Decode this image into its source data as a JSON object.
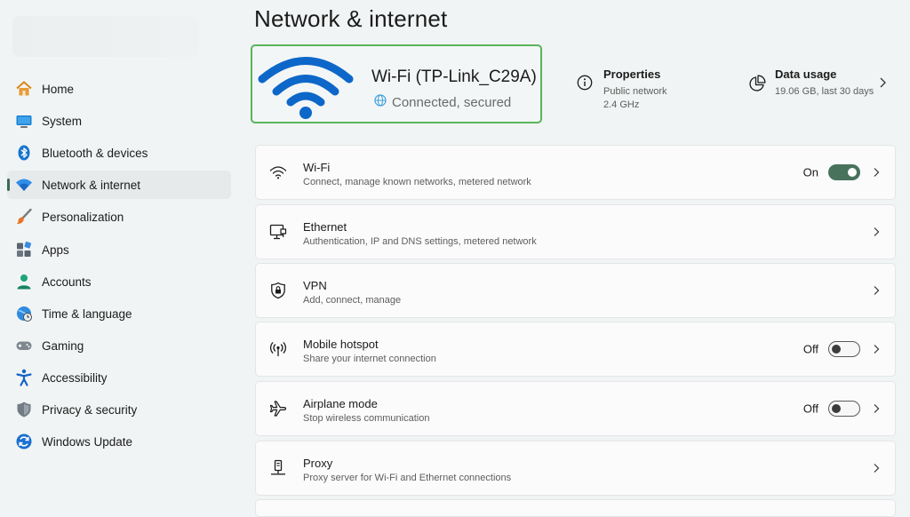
{
  "page": {
    "title": "Network & internet"
  },
  "sidebar": {
    "items": [
      {
        "label": "Home",
        "icon": "home-icon"
      },
      {
        "label": "System",
        "icon": "system-icon"
      },
      {
        "label": "Bluetooth & devices",
        "icon": "bluetooth-icon"
      },
      {
        "label": "Network & internet",
        "icon": "network-icon",
        "active": true
      },
      {
        "label": "Personalization",
        "icon": "brush-icon"
      },
      {
        "label": "Apps",
        "icon": "apps-icon"
      },
      {
        "label": "Accounts",
        "icon": "accounts-icon"
      },
      {
        "label": "Time & language",
        "icon": "time-language-icon"
      },
      {
        "label": "Gaming",
        "icon": "gamepad-icon"
      },
      {
        "label": "Accessibility",
        "icon": "accessibility-icon"
      },
      {
        "label": "Privacy & security",
        "icon": "shield-icon"
      },
      {
        "label": "Windows Update",
        "icon": "update-icon"
      }
    ]
  },
  "hero": {
    "ssid": "Wi-Fi (TP-Link_C29A)",
    "status": "Connected, secured",
    "accent": "#5bb35d",
    "wifi_color": "#0d67c9"
  },
  "properties": {
    "title": "Properties",
    "line1": "Public network",
    "line2": "2.4 GHz"
  },
  "data_usage": {
    "title": "Data usage",
    "detail": "19.06 GB, last 30 days"
  },
  "cards": [
    {
      "title": "Wi-Fi",
      "subtitle": "Connect, manage known networks, metered network",
      "state": "On",
      "icon": "wifi-icon"
    },
    {
      "title": "Ethernet",
      "subtitle": "Authentication, IP and DNS settings, metered network",
      "icon": "ethernet-icon"
    },
    {
      "title": "VPN",
      "subtitle": "Add, connect, manage",
      "icon": "vpn-shield-icon"
    },
    {
      "title": "Mobile hotspot",
      "subtitle": "Share your internet connection",
      "state": "Off",
      "icon": "hotspot-icon"
    },
    {
      "title": "Airplane mode",
      "subtitle": "Stop wireless communication",
      "state": "Off",
      "icon": "airplane-icon"
    },
    {
      "title": "Proxy",
      "subtitle": "Proxy server for Wi-Fi and Ethernet connections",
      "icon": "proxy-icon"
    }
  ],
  "colors": {
    "toggle_on": "#48725c",
    "background": "#f1f4f4",
    "card": "#fbfbfb"
  }
}
